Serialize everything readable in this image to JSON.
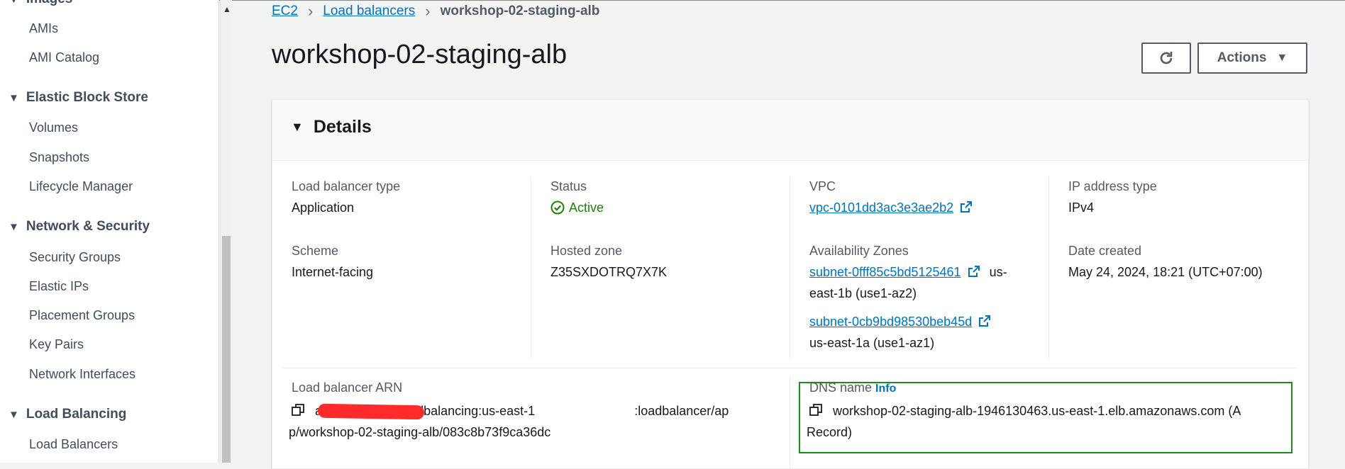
{
  "sidebar": {
    "partial_top": "Images",
    "images_items": [
      "AMIs",
      "AMI Catalog"
    ],
    "ebs_group": "Elastic Block Store",
    "ebs_items": [
      "Volumes",
      "Snapshots",
      "Lifecycle Manager"
    ],
    "netsec_group": "Network & Security",
    "netsec_items": [
      "Security Groups",
      "Elastic IPs",
      "Placement Groups",
      "Key Pairs",
      "Network Interfaces"
    ],
    "lb_group": "Load Balancing",
    "lb_items": [
      "Load Balancers"
    ]
  },
  "breadcrumb": {
    "ec2": "EC2",
    "lbs": "Load balancers",
    "current": "workshop-02-staging-alb"
  },
  "page_title": "workshop-02-staging-alb",
  "actions": {
    "label": "Actions"
  },
  "details": {
    "title": "Details",
    "lb_type_label": "Load balancer type",
    "lb_type_value": "Application",
    "status_label": "Status",
    "status_value": "Active",
    "vpc_label": "VPC",
    "vpc_value": "vpc-0101dd3ac3e3ae2b2",
    "ip_type_label": "IP address type",
    "ip_type_value": "IPv4",
    "scheme_label": "Scheme",
    "scheme_value": "Internet-facing",
    "hosted_zone_label": "Hosted zone",
    "hosted_zone_value": "Z35SXDOTRQ7X7K",
    "az_label": "Availability Zones",
    "az1_subnet": "subnet-0fff85c5bd5125461",
    "az1_suffix": "us-",
    "az1_line2": "east-1b (use1-az2)",
    "az2_subnet": "subnet-0cb9bd98530beb45d",
    "az2_line2": "us-east-1a (use1-az1)",
    "date_label": "Date created",
    "date_value": "May 24, 2024, 18:21 (UTC+07:00)",
    "arn_label": "Load balancer ARN",
    "arn_line1_a": "arn:aws:elasticloadbalancing:us-east-1",
    "arn_line1_b": ":loadbalancer/ap",
    "arn_line2": "p/workshop-02-staging-alb/083c8b73f9ca36dc",
    "dns_label": "DNS name",
    "dns_info": "Info",
    "dns_line1": "workshop-02-staging-alb-1946130463.us-east-1.elb.amazonaws.com (A",
    "dns_line2": "Record)"
  }
}
